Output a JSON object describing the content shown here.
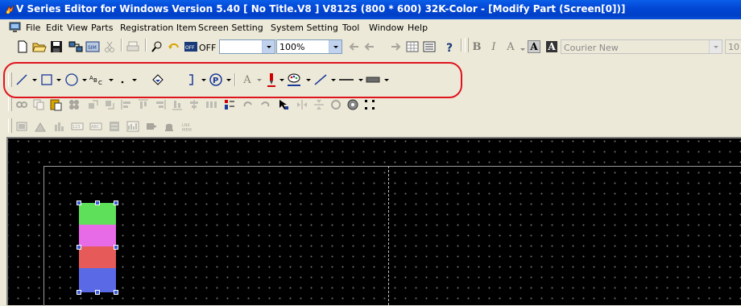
{
  "window": {
    "title": "V Series Editor for Windows Version 5.40 [ No Title.V8 ] V812S (800 * 600) 32K-Color - [Modify Part (Screen[0])]"
  },
  "menubar": {
    "items": [
      "File",
      "Edit",
      "View",
      "Parts",
      "Registration Item",
      "Screen Setting",
      "System Setting",
      "Tool",
      "Window",
      "Help"
    ]
  },
  "toolbar1": {
    "off_label": "OFF",
    "zoom_value": "100%",
    "font_name": "Courier New",
    "font_size": "10"
  },
  "colors": {
    "highlight_border": "#e0141e",
    "workspace_bg": "#000000",
    "titlebar_blue": "#0a5ee8",
    "part_green": "#5fe05a",
    "part_magenta": "#e76be6",
    "part_red": "#e65a5a",
    "part_blue": "#5a6ae6"
  },
  "icons": {
    "draw_toolbar": [
      "line-icon",
      "rectangle-icon",
      "circle-icon",
      "text-icon",
      "dot-icon",
      "fill-icon",
      "bracket-icon",
      "pattern-icon",
      "font-a-icon",
      "pen-color-icon",
      "paint-color-icon",
      "line-style-icon",
      "line-width-icon",
      "fill-color-icon"
    ]
  }
}
